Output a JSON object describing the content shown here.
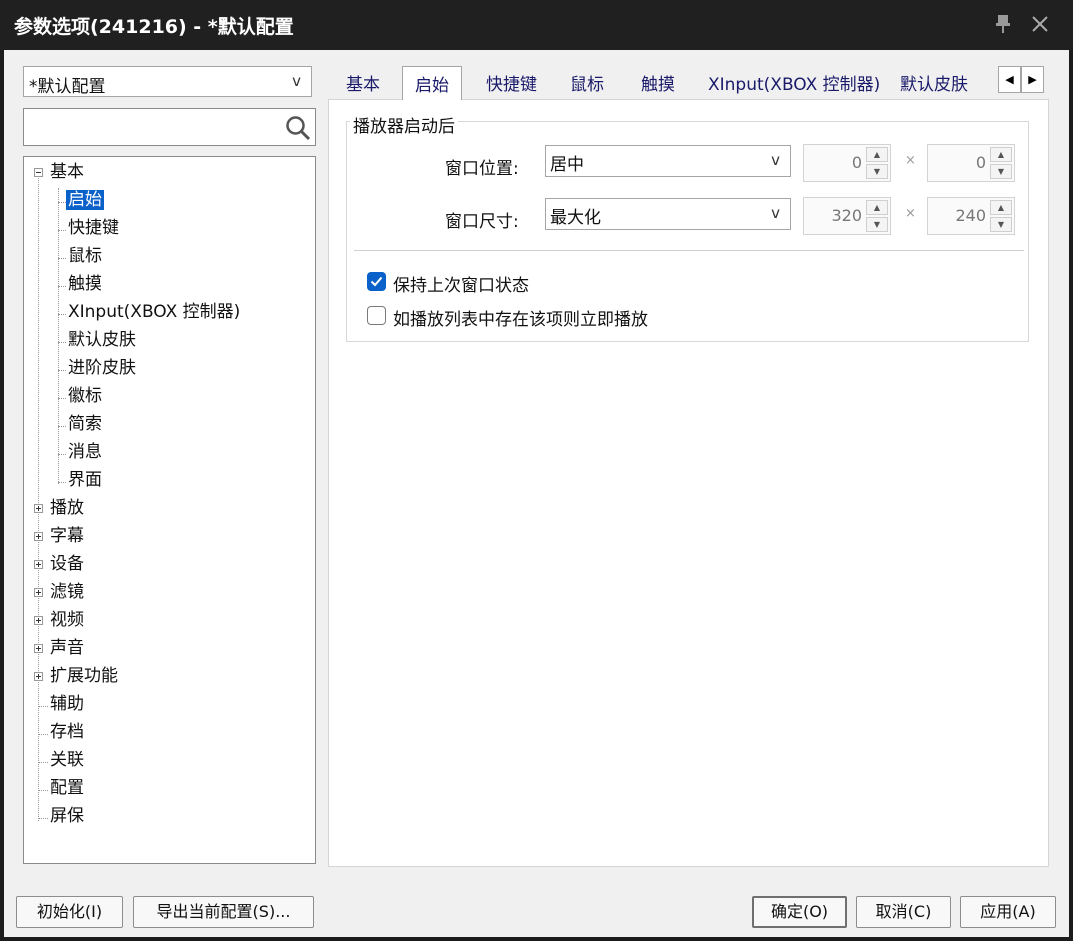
{
  "window": {
    "title": "参数选项(241216) - *默认配置",
    "pin_icon": "pin-icon",
    "close_icon": "close-icon"
  },
  "profile_select": {
    "value": "*默认配置",
    "arrow": "v"
  },
  "search": {
    "placeholder": "",
    "icon": "search-icon"
  },
  "tree": {
    "nodes": [
      {
        "label": "基本",
        "expanded": true
      },
      {
        "label": "启始",
        "selected": true
      },
      {
        "label": "快捷键"
      },
      {
        "label": "鼠标"
      },
      {
        "label": "触摸"
      },
      {
        "label": "XInput(XBOX 控制器)"
      },
      {
        "label": "默认皮肤"
      },
      {
        "label": "进阶皮肤"
      },
      {
        "label": "徽标"
      },
      {
        "label": "简索"
      },
      {
        "label": "消息"
      },
      {
        "label": "界面"
      },
      {
        "label": "播放"
      },
      {
        "label": "字幕"
      },
      {
        "label": "设备"
      },
      {
        "label": "滤镜"
      },
      {
        "label": "视频"
      },
      {
        "label": "声音"
      },
      {
        "label": "扩展功能"
      },
      {
        "label": "辅助"
      },
      {
        "label": "存档"
      },
      {
        "label": "关联"
      },
      {
        "label": "配置"
      },
      {
        "label": "屏保"
      }
    ]
  },
  "tabs": [
    {
      "label": "基本"
    },
    {
      "label": "启始",
      "active": true
    },
    {
      "label": "快捷键"
    },
    {
      "label": "鼠标"
    },
    {
      "label": "触摸"
    },
    {
      "label": "XInput(XBOX 控制器)"
    },
    {
      "label": "默认皮肤"
    }
  ],
  "tab_scroll": {
    "left": "◀",
    "right": "▶"
  },
  "group": {
    "title": "播放器启动后",
    "position": {
      "label": "窗口位置:",
      "value": "居中",
      "arrow": "v",
      "x": "0",
      "y": "0",
      "sep": "×"
    },
    "size": {
      "label": "窗口尺寸:",
      "value": "最大化",
      "arrow": "v",
      "w": "320",
      "h": "240",
      "sep": "×"
    },
    "keep_state": {
      "label": "保持上次窗口状态",
      "checked": true
    },
    "play_if_listed": {
      "label": "如播放列表中存在该项则立即播放",
      "checked": false
    }
  },
  "buttons": {
    "init": "初始化(I)",
    "export": "导出当前配置(S)...",
    "ok": "确定(O)",
    "cancel": "取消(C)",
    "apply": "应用(A)"
  },
  "colors": {
    "accent": "#0b61ca",
    "titlebar": "#202020"
  }
}
